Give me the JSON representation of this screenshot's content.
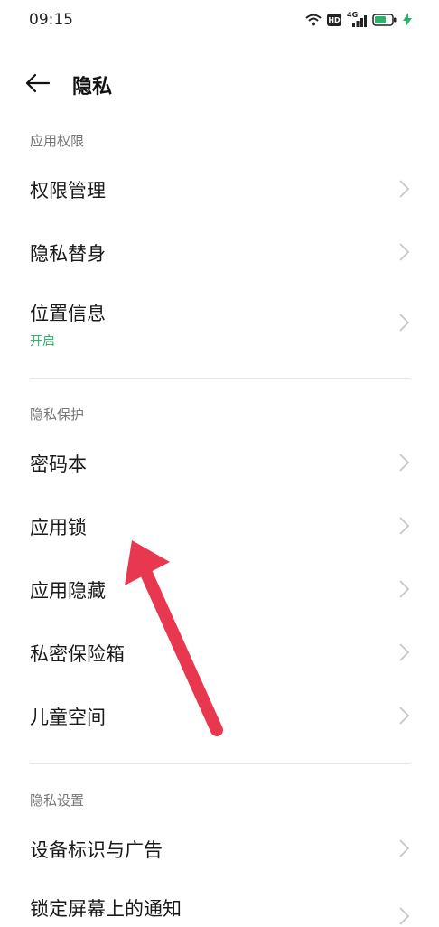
{
  "status_bar": {
    "time": "09:15",
    "hd_label": "HD",
    "network_label": "4G",
    "icons": [
      "wifi-icon",
      "hd-icon",
      "signal-icon",
      "battery-icon",
      "charging-icon"
    ]
  },
  "header": {
    "title": "隐私",
    "back_icon": "arrow-left-icon"
  },
  "sections": [
    {
      "title": "应用权限",
      "items": [
        {
          "label": "权限管理"
        },
        {
          "label": "隐私替身"
        },
        {
          "label": "位置信息",
          "sub": "开启"
        }
      ]
    },
    {
      "title": "隐私保护",
      "items": [
        {
          "label": "密码本"
        },
        {
          "label": "应用锁"
        },
        {
          "label": "应用隐藏"
        },
        {
          "label": "私密保险箱"
        },
        {
          "label": "儿童空间"
        }
      ]
    },
    {
      "title": "隐私设置",
      "items": [
        {
          "label": "设备标识与广告"
        },
        {
          "label": "锁定屏幕上的通知"
        }
      ]
    }
  ],
  "colors": {
    "accent_green": "#2bb36a",
    "annotation_arrow": "#e8384f"
  }
}
